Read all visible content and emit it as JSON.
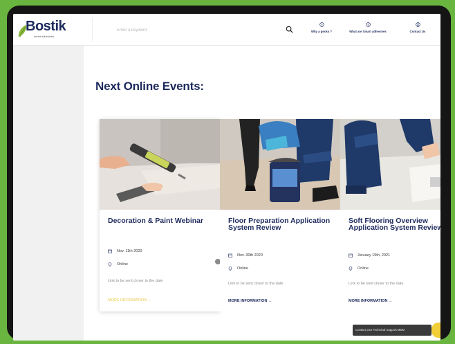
{
  "brand": {
    "name": "Bostik",
    "tagline": "smart adhesives"
  },
  "search": {
    "placeholder": "Enter a keyword"
  },
  "nav": [
    {
      "label": "Why a gecko ?",
      "icon": "question-circle-icon"
    },
    {
      "label": "What are Smart adhesives",
      "icon": "question-circle-icon"
    },
    {
      "label": "Contact Us",
      "icon": "user-icon"
    }
  ],
  "page": {
    "heading": "Next Online Events:"
  },
  "cards": [
    {
      "title": "Decoration & Paint Webinar",
      "date": "Nov. 11th 2020",
      "location": "Online",
      "description": "Link to be sent closer to the date",
      "more": "MORE INFORMATION →"
    },
    {
      "title": "Floor Preparation Application System Review",
      "date": "Nov. 30th 2020",
      "location": "Online",
      "description": "Link to be sent closer to the date",
      "more": "MORE INFORMATION →"
    },
    {
      "title": "Soft Flooring Overview Application System Review",
      "date": "January 19th, 2021",
      "location": "Online",
      "description": "Link to be sent closer to the date",
      "more": "MORE INFORMATION →"
    }
  ],
  "toast": {
    "text": "Contact your Technical Support MDM"
  },
  "colors": {
    "brand_navy": "#1d2a5d",
    "background_green": "#6ab53f",
    "accent_yellow": "#f2cf39"
  }
}
